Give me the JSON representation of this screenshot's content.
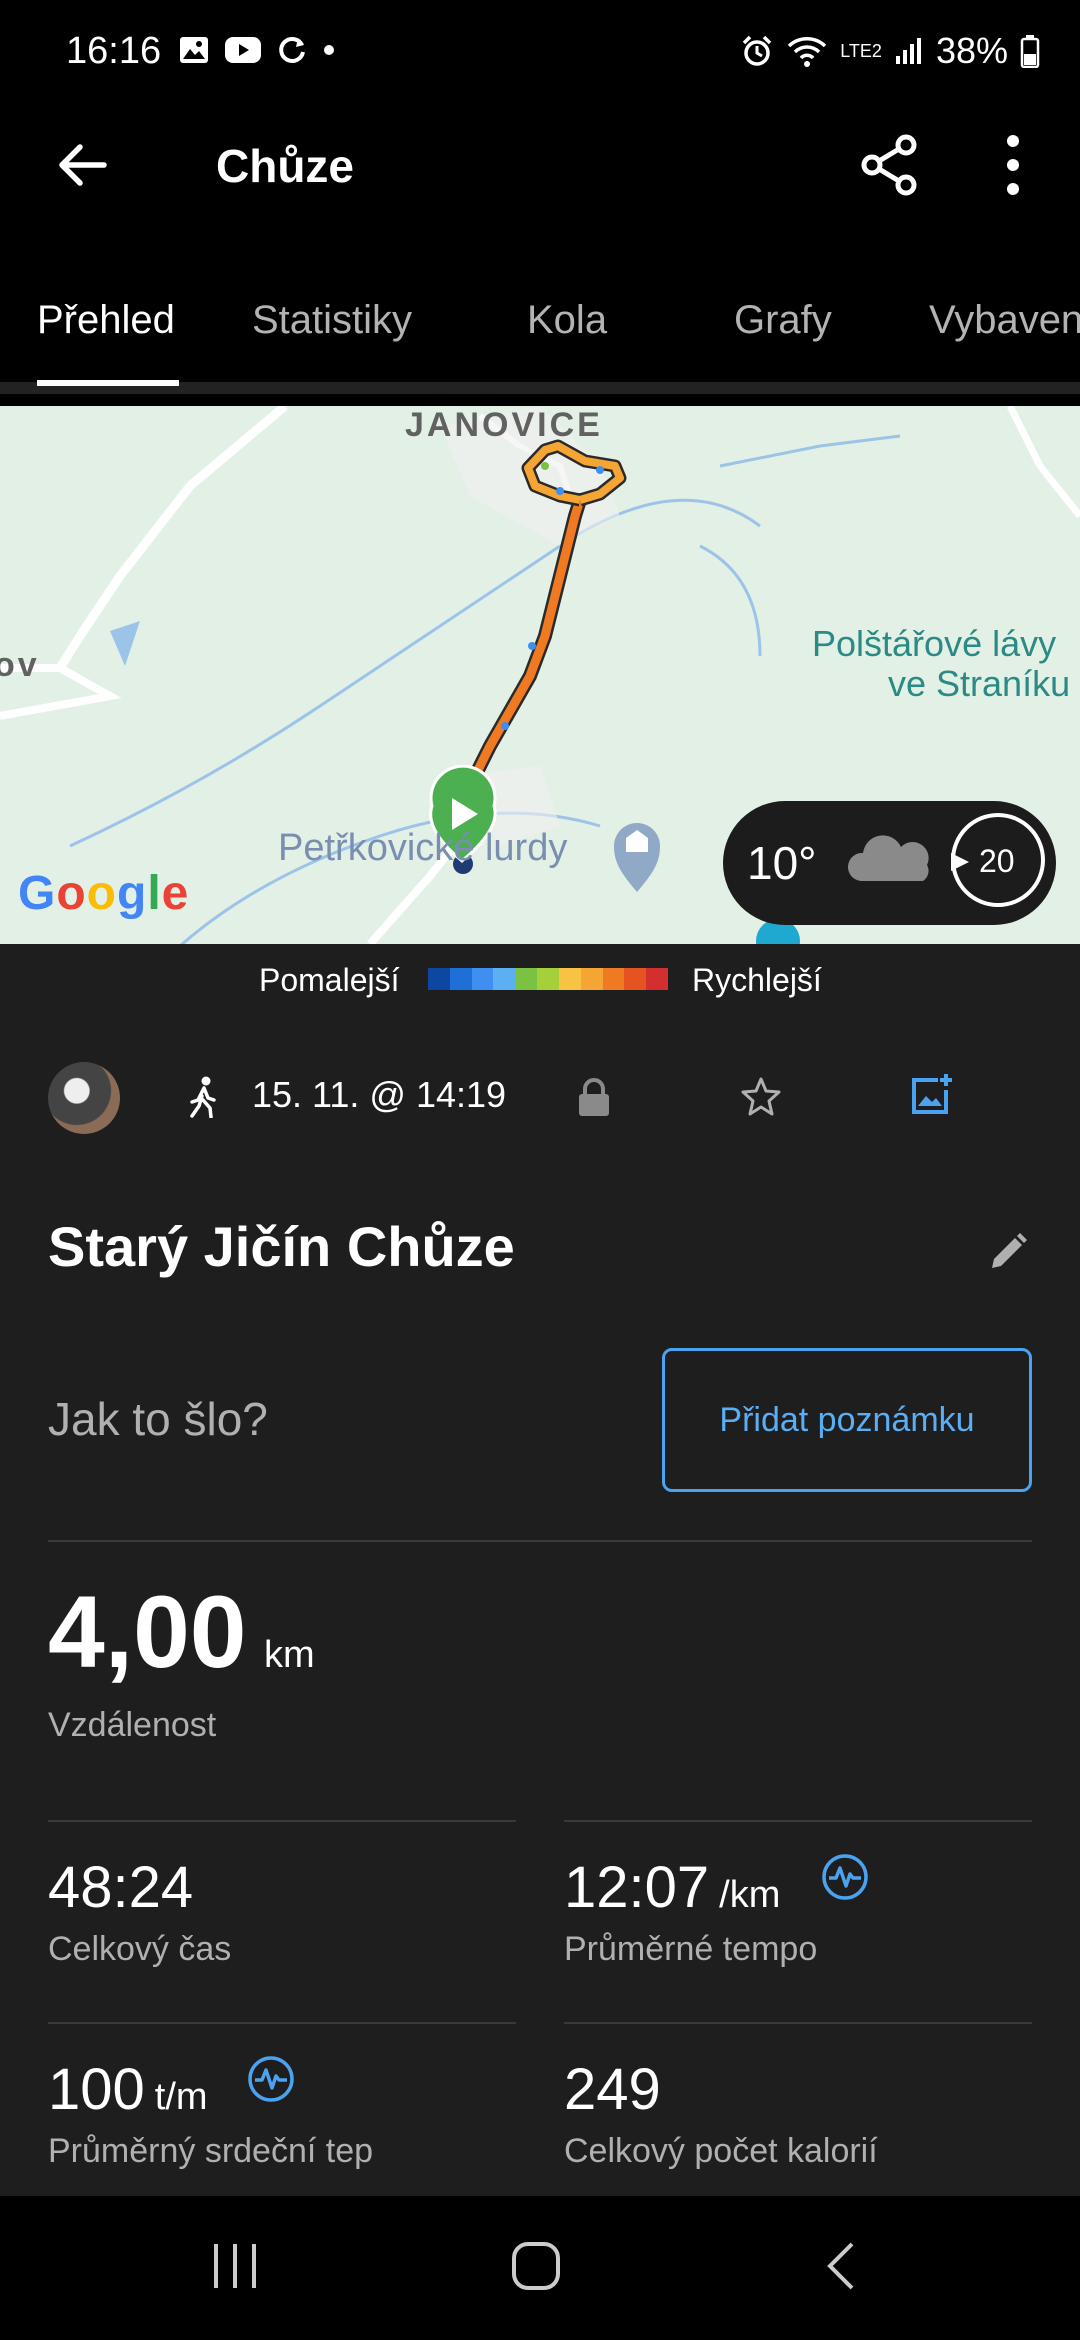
{
  "status_bar": {
    "time": "16:16",
    "battery": "38%",
    "network": "LTE2",
    "icons": [
      "gallery-icon",
      "youtube-icon",
      "sync-icon",
      "dot-icon",
      "alarm-icon",
      "wifi-icon",
      "signal-icon",
      "battery-icon"
    ]
  },
  "app_bar": {
    "title": "Chůze",
    "icons": [
      "back-arrow-icon",
      "share-icon",
      "more-vert-icon"
    ]
  },
  "tabs": [
    {
      "label": "Přehled",
      "active": true
    },
    {
      "label": "Statistiky",
      "active": false
    },
    {
      "label": "Kola",
      "active": false
    },
    {
      "label": "Grafy",
      "active": false
    },
    {
      "label": "Vybaven",
      "active": false
    }
  ],
  "map": {
    "places": [
      "JANOVICE",
      "Polštářové lávy",
      "ve Straníku",
      "Petřkovické lurdy",
      "ov"
    ],
    "attribution": "Google",
    "weather": {
      "temperature": "10°",
      "condition_icon": "cloud-icon",
      "wind": "20"
    }
  },
  "speed_legend": {
    "slower": "Pomalejší",
    "faster": "Rychlejší",
    "colors": [
      "#0d47a1",
      "#1e6fd6",
      "#3f8ff0",
      "#5bb0f2",
      "#7cc242",
      "#a6d03a",
      "#f6c343",
      "#f4a533",
      "#f07a22",
      "#e45320",
      "#d32f2f"
    ]
  },
  "activity": {
    "date": "15. 11. @ 14:19",
    "title": "Starý Jičín Chůze",
    "prompt": "Jak to šlo?",
    "add_note": "Přidat poznámku",
    "distance": {
      "value": "4,00",
      "unit": "km",
      "label": "Vzdálenost"
    },
    "stats": [
      {
        "value": "48:24",
        "unit": "",
        "label": "Celkový čas"
      },
      {
        "value": "12:07",
        "unit": "/km",
        "label": "Průměrné tempo"
      },
      {
        "value": "100",
        "unit": "t/m",
        "label": "Průměrný srdeční tep"
      },
      {
        "value": "249",
        "unit": "",
        "label": "Celkový počet kalorií"
      }
    ]
  },
  "accent_color": "#4aa3f0"
}
